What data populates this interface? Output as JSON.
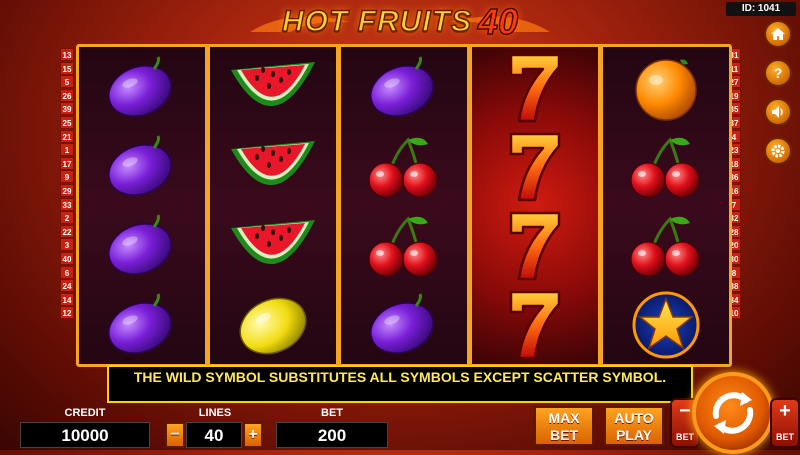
{
  "header": {
    "title": "HOT FRUITS",
    "title_number": "40",
    "game_id": "ID: 1041"
  },
  "lines_left": [
    "13",
    "15",
    "5",
    "26",
    "39",
    "25",
    "21",
    "1",
    "17",
    "9",
    "29",
    "33",
    "2",
    "22",
    "3",
    "40",
    "6",
    "24",
    "14",
    "12"
  ],
  "lines_right": [
    "31",
    "11",
    "27",
    "19",
    "35",
    "37",
    "4",
    "23",
    "18",
    "36",
    "16",
    "7",
    "32",
    "28",
    "20",
    "30",
    "8",
    "38",
    "34",
    "10"
  ],
  "reels": [
    [
      "plum",
      "plum",
      "plum",
      "plum"
    ],
    [
      "watermelon",
      "watermelon",
      "watermelon",
      "lemon"
    ],
    [
      "plum",
      "cherry",
      "cherry",
      "plum"
    ],
    [
      "seven",
      "seven",
      "seven",
      "seven"
    ],
    [
      "orange",
      "cherry",
      "cherry",
      "star"
    ]
  ],
  "message": "THE WILD SYMBOL SUBSTITUTES ALL SYMBOLS EXCEPT SCATTER SYMBOL.",
  "credit": {
    "label": "CREDIT",
    "value": "10000"
  },
  "lines": {
    "label": "LINES",
    "value": "40",
    "minus": "−",
    "plus": "+"
  },
  "bet": {
    "label": "BET",
    "value": "200"
  },
  "buttons": {
    "max_bet": [
      "MAX",
      "BET"
    ],
    "auto_play": [
      "AUTO",
      "PLAY"
    ],
    "bet_minus": {
      "sign": "−",
      "label": "BET"
    },
    "bet_plus": {
      "sign": "+",
      "label": "BET"
    }
  },
  "side_buttons": [
    "home-icon",
    "help-icon",
    "sound-icon",
    "settings-icon"
  ],
  "colors": {
    "accent": "#f4a521",
    "message_text": "#ffe85a",
    "button_orange": "#ffa321",
    "background": "#a3230d"
  }
}
